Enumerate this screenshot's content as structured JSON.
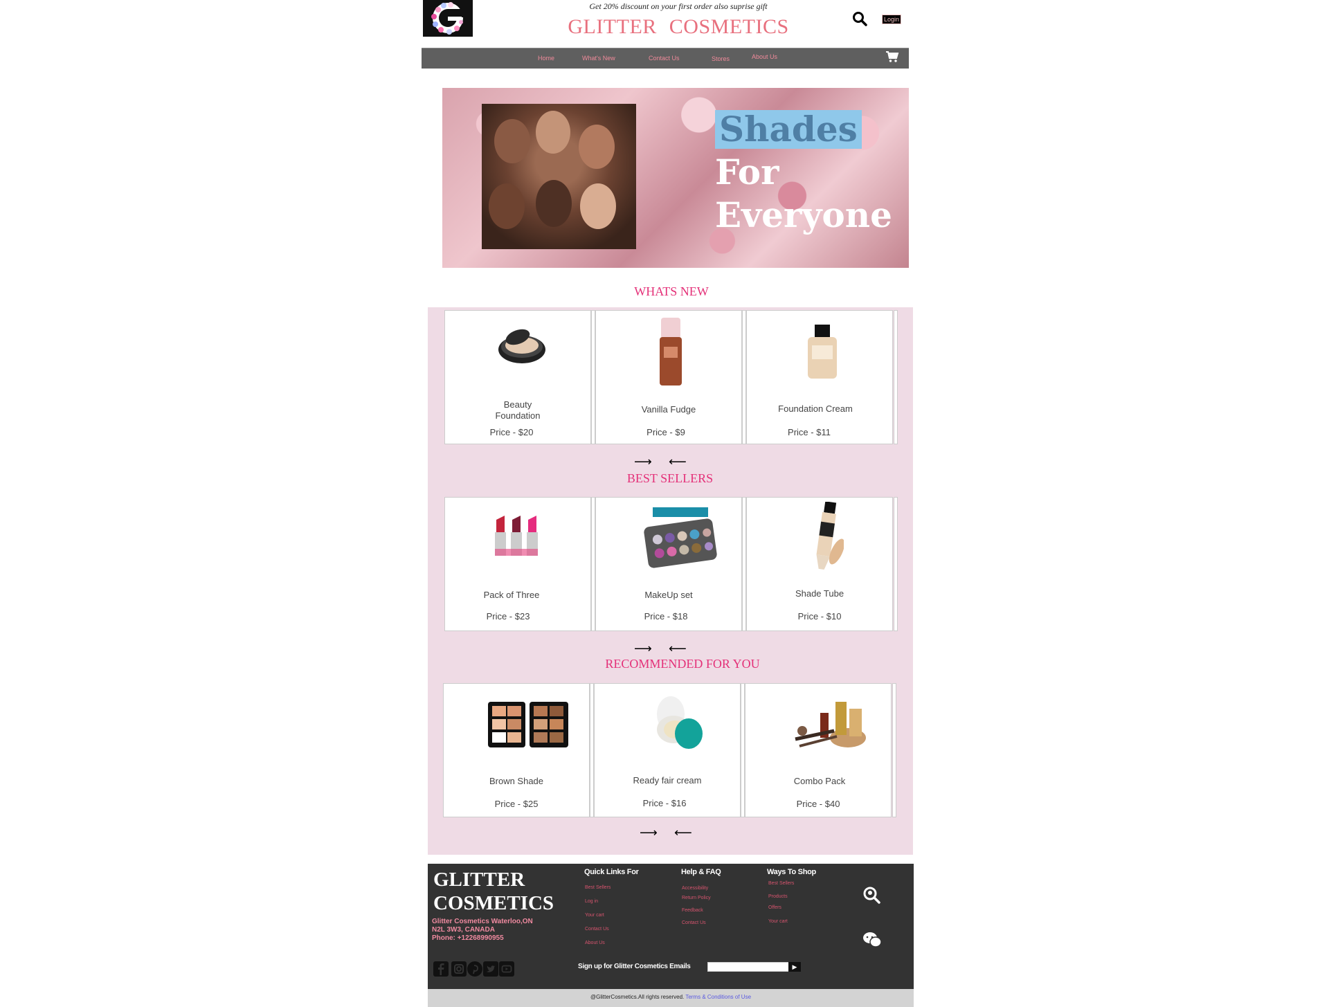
{
  "header": {
    "promo": "Get 20% discount on your first order also suprise gift",
    "brand": "GLITTER COSMETICS",
    "login_label": "Login"
  },
  "nav": {
    "items": [
      "Home",
      "What's New",
      "Contact Us",
      "Stores",
      "About Us"
    ]
  },
  "hero": {
    "line1": "Shades",
    "line2": "For",
    "line3": "Everyone"
  },
  "sections": [
    {
      "title": "WHATS NEW",
      "products": [
        {
          "name_line1": "Beauty",
          "name_line2": "Foundation",
          "price": "Price - $20"
        },
        {
          "name_line1": "Vanilla Fudge",
          "name_line2": "",
          "price": "Price - $9"
        },
        {
          "name_line1": "Foundation Cream",
          "name_line2": "",
          "price": "Price - $11"
        }
      ]
    },
    {
      "title": "BEST SELLERS",
      "products": [
        {
          "name_line1": "Pack of Three",
          "name_line2": "",
          "price": "Price - $23"
        },
        {
          "name_line1": "MakeUp set",
          "name_line2": "",
          "price": "Price - $18"
        },
        {
          "name_line1": "Shade Tube",
          "name_line2": "",
          "price": "Price - $10"
        }
      ]
    },
    {
      "title": "RECOMMENDED FOR YOU",
      "products": [
        {
          "name_line1": "Brown Shade",
          "name_line2": "",
          "price": "Price - $25"
        },
        {
          "name_line1": "Ready fair cream",
          "name_line2": "",
          "price": "Price - $16"
        },
        {
          "name_line1": "Combo Pack",
          "name_line2": "",
          "price": "Price - $40"
        }
      ]
    }
  ],
  "carousel": {
    "next_arrow": "⟶",
    "prev_arrow": "⟵"
  },
  "footer": {
    "brand_line1": "GLITTER",
    "brand_line2": "COSMETICS",
    "address_line1": "Glitter Cosmetics Waterloo,ON",
    "address_line2": "N2L 3W3, CANADA",
    "phone": "Phone: +12268990955",
    "quick_links": {
      "title": "Quick Links For",
      "links": [
        "Best Sellers",
        "Log in",
        "Your cart",
        "Contact Us",
        "About Us"
      ]
    },
    "help": {
      "title": "Help & FAQ",
      "links": [
        "Accessibility",
        "Return Policy",
        "Feedback",
        "Contact Us"
      ]
    },
    "ways": {
      "title": "Ways To Shop",
      "links": [
        "Best Sellers",
        "Products",
        "Offers",
        "Your cart"
      ]
    },
    "signup_label": "Sign up for Glitter Cosmetics Emails",
    "signup_button": "▶",
    "social": [
      "facebook-icon",
      "instagram-icon",
      "pinterest-icon",
      "twitter-icon",
      "youtube-icon"
    ],
    "copyright": "@GlitterCosmetics.All rights reserved.",
    "terms": "Terms & Conditions of Use"
  },
  "colors": {
    "brand_pink": "#e8707e",
    "section_title": "#e43078",
    "products_bg": "#efdbe5",
    "nav_bg": "#5f5f5f",
    "footer_bg": "#333333"
  }
}
